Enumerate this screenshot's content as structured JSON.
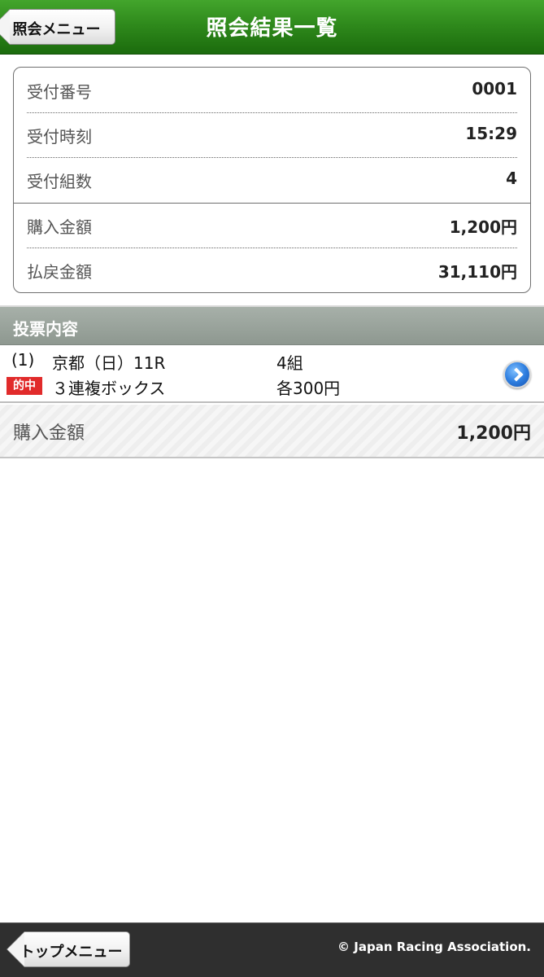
{
  "header": {
    "title": "照会結果一覧",
    "back_label": "照会メニュー"
  },
  "summary": {
    "rows": [
      {
        "label": "受付番号",
        "value": "0001"
      },
      {
        "label": "受付時刻",
        "value": "15:29"
      },
      {
        "label": "受付組数",
        "value": "4"
      },
      {
        "label": "購入金額",
        "value": "1,200円"
      },
      {
        "label": "払戻金額",
        "value": "31,110円"
      }
    ]
  },
  "section": {
    "title": "投票内容"
  },
  "bet": {
    "index": "(1)",
    "race": "京都（日）11R",
    "combos": "4組",
    "badge": "的中",
    "type": "３連複ボックス",
    "amount": "各300円"
  },
  "total": {
    "label": "購入金額",
    "value": "1,200円"
  },
  "footer": {
    "back_label": "トップメニュー",
    "copyright": "© Japan Racing Association."
  },
  "colors": {
    "header_green": "#2f8a1c",
    "hit_red": "#e12b2b",
    "section_gray": "#96a098",
    "footer_dark": "#2f2f2f"
  }
}
